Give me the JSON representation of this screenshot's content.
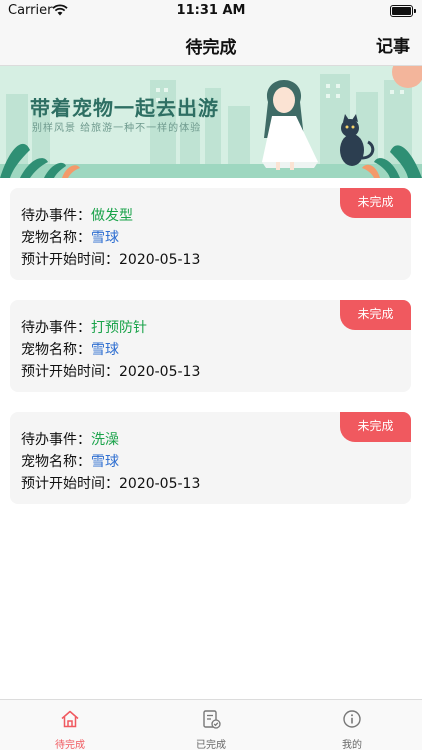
{
  "status_bar": {
    "carrier": "Carrier",
    "time": "11:31 AM"
  },
  "nav": {
    "title": "待完成",
    "right_button": "记事"
  },
  "banner": {
    "title": "带着宠物一起去出游",
    "subtitle": "别样风景 给旅游一种不一样的体验"
  },
  "labels": {
    "event": "待办事件：",
    "pet": "宠物名称：",
    "start": "预计开始时间："
  },
  "cards": [
    {
      "event": "做发型",
      "pet": "雪球",
      "start_date": "2020-05-13",
      "status": "未完成"
    },
    {
      "event": "打预防针",
      "pet": "雪球",
      "start_date": "2020-05-13",
      "status": "未完成"
    },
    {
      "event": "洗澡",
      "pet": "雪球",
      "start_date": "2020-05-13",
      "status": "未完成"
    }
  ],
  "tabs": [
    {
      "label": "待完成",
      "icon": "home-icon",
      "active": true
    },
    {
      "label": "已完成",
      "icon": "checklist-icon",
      "active": false
    },
    {
      "label": "我的",
      "icon": "info-icon",
      "active": false
    }
  ],
  "colors": {
    "accent": "#f0595f",
    "event_value": "#1aa34a",
    "pet_value": "#2f6fd1",
    "card_bg": "#f5f5f5",
    "banner_bg": "#d6efe3"
  }
}
